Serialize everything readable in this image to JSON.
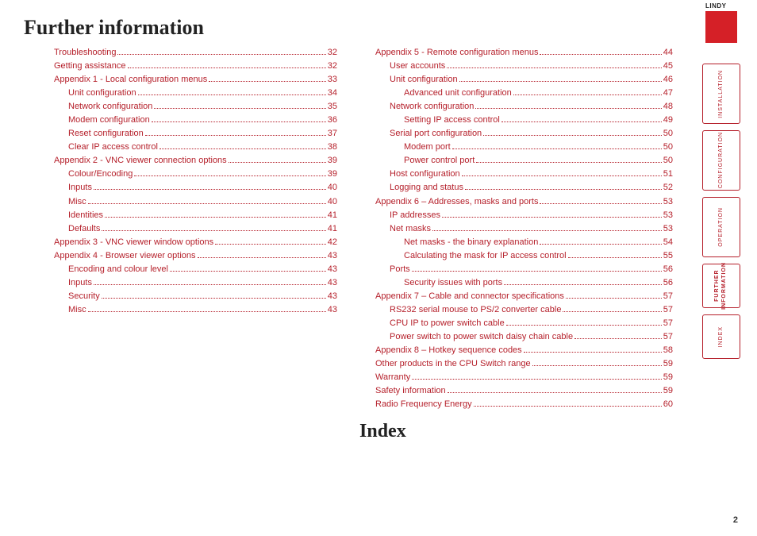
{
  "headings": {
    "further_info": "Further information",
    "index": "Index"
  },
  "logo": "LINDY",
  "page_number": "2",
  "nav": [
    {
      "label": "INSTALLATION",
      "active": false,
      "short": false
    },
    {
      "label": "CONFIGURATION",
      "active": false,
      "short": false
    },
    {
      "label": "OPERATION",
      "active": false,
      "short": false
    },
    {
      "label": "FURTHER\nINFORMATION",
      "active": true,
      "short": true
    },
    {
      "label": "INDEX",
      "active": false,
      "short": true
    }
  ],
  "col1": [
    {
      "label": "Troubleshooting",
      "page": "32",
      "indent": 1
    },
    {
      "label": "Getting assistance",
      "page": "32",
      "indent": 1
    },
    {
      "label": "Appendix 1 - Local configuration menus",
      "page": "33",
      "indent": 1
    },
    {
      "label": "Unit configuration",
      "page": "34",
      "indent": 2
    },
    {
      "label": "Network configuration",
      "page": "35",
      "indent": 2
    },
    {
      "label": "Modem configuration",
      "page": "36",
      "indent": 2
    },
    {
      "label": "Reset configuration",
      "page": "37",
      "indent": 2
    },
    {
      "label": "Clear IP access control",
      "page": "38",
      "indent": 2
    },
    {
      "label": "Appendix 2 - VNC viewer connection options",
      "page": "39",
      "indent": 1
    },
    {
      "label": "Colour/Encoding",
      "page": "39",
      "indent": 2
    },
    {
      "label": "Inputs",
      "page": "40",
      "indent": 2
    },
    {
      "label": "Misc",
      "page": "40",
      "indent": 2
    },
    {
      "label": "Identities",
      "page": "41",
      "indent": 2
    },
    {
      "label": "Defaults",
      "page": "41",
      "indent": 2
    },
    {
      "label": "Appendix 3 - VNC viewer window options",
      "page": "42",
      "indent": 1
    },
    {
      "label": "Appendix 4 - Browser viewer options",
      "page": "43",
      "indent": 1
    },
    {
      "label": "Encoding and colour level",
      "page": "43",
      "indent": 2
    },
    {
      "label": "Inputs",
      "page": "43",
      "indent": 2
    },
    {
      "label": "Security",
      "page": "43",
      "indent": 2
    },
    {
      "label": "Misc",
      "page": "43",
      "indent": 2
    }
  ],
  "col2": [
    {
      "label": "Appendix 5 - Remote configuration menus",
      "page": "44",
      "indent": 0
    },
    {
      "label": "User accounts",
      "page": "45",
      "indent": 1
    },
    {
      "label": "Unit configuration",
      "page": "46",
      "indent": 1
    },
    {
      "label": "Advanced unit configuration",
      "page": "47",
      "indent": 2
    },
    {
      "label": "Network configuration",
      "page": "48",
      "indent": 1
    },
    {
      "label": "Setting IP access control",
      "page": "49",
      "indent": 2
    },
    {
      "label": "Serial port configuration",
      "page": "50",
      "indent": 1
    },
    {
      "label": "Modem port",
      "page": "50",
      "indent": 2
    },
    {
      "label": "Power control port",
      "page": "50",
      "indent": 2
    },
    {
      "label": "Host configuration",
      "page": "51",
      "indent": 1
    },
    {
      "label": "Logging and status",
      "page": "52",
      "indent": 1
    },
    {
      "label": "Appendix 6 – Addresses, masks and ports",
      "page": "53",
      "indent": 0
    },
    {
      "label": "IP addresses",
      "page": "53",
      "indent": 1
    },
    {
      "label": "Net masks",
      "page": "53",
      "indent": 1
    },
    {
      "label": "Net masks - the binary explanation",
      "page": "54",
      "indent": 2
    },
    {
      "label": "Calculating the mask for IP access control",
      "page": "55",
      "indent": 2
    },
    {
      "label": "Ports",
      "page": "56",
      "indent": 1
    },
    {
      "label": "Security issues with ports",
      "page": "56",
      "indent": 2
    },
    {
      "label": "Appendix 7 – Cable and connector specifications",
      "page": "57",
      "indent": 0
    },
    {
      "label": "RS232 serial mouse to PS/2 converter cable",
      "page": "57",
      "indent": 1
    },
    {
      "label": "CPU IP to power switch cable",
      "page": "57",
      "indent": 1
    },
    {
      "label": "Power switch to power switch daisy chain cable",
      "page": "57",
      "indent": 1
    },
    {
      "label": "Appendix 8 – Hotkey sequence codes",
      "page": "58",
      "indent": 0
    },
    {
      "label": "Other products in the CPU Switch range",
      "page": "59",
      "indent": 0
    },
    {
      "label": "Warranty",
      "page": "59",
      "indent": 0
    },
    {
      "label": "Safety information",
      "page": "59",
      "indent": 0
    },
    {
      "label": "Radio Frequency Energy",
      "page": "60",
      "indent": 0
    }
  ]
}
